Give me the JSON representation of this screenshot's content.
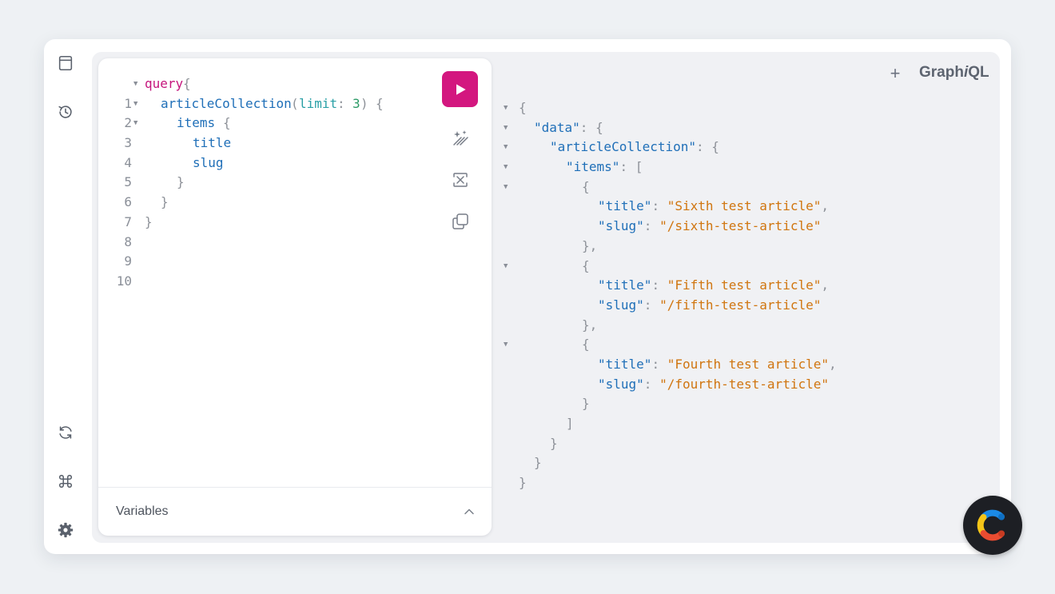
{
  "header": {
    "brand_prefix": "Graph",
    "brand_italic": "i",
    "brand_suffix": "QL",
    "add_tab_label": "+"
  },
  "editor": {
    "line_numbers": [
      "1",
      "2",
      "3",
      "4",
      "5",
      "6",
      "7",
      "8",
      "9",
      "10"
    ],
    "tokens": {
      "query_kw": "query",
      "open_brace": "{",
      "article_collection": "articleCollection",
      "paren_open": "(",
      "arg_name": "limit",
      "colon": ":",
      "arg_value": "3",
      "paren_close": ")",
      "items": "items",
      "title": "title",
      "slug": "slug",
      "close_brace": "}"
    }
  },
  "variables": {
    "label": "Variables"
  },
  "result": {
    "keys": {
      "data": "\"data\"",
      "articleCollection": "\"articleCollection\"",
      "items": "\"items\"",
      "title": "\"title\"",
      "slug": "\"slug\""
    },
    "items": [
      {
        "title": "\"Sixth test article\"",
        "slug": "\"/sixth-test-article\""
      },
      {
        "title": "\"Fifth test article\"",
        "slug": "\"/fifth-test-article\""
      },
      {
        "title": "\"Fourth test article\"",
        "slug": "\"/fourth-test-article\""
      }
    ]
  },
  "colors": {
    "accent": "#d3177f",
    "string": "#d0750f",
    "key": "#1f6fb8",
    "keyword": "#c5157d",
    "number": "#2b9a66"
  },
  "icons": {
    "sidebar_top": [
      "docs-icon",
      "history-icon"
    ],
    "sidebar_bottom": [
      "refresh-icon",
      "command-icon",
      "settings-icon"
    ],
    "toolbar": [
      "play-icon",
      "prettify-icon",
      "merge-icon",
      "copy-icon"
    ],
    "fab": "contentful-logo-icon"
  }
}
